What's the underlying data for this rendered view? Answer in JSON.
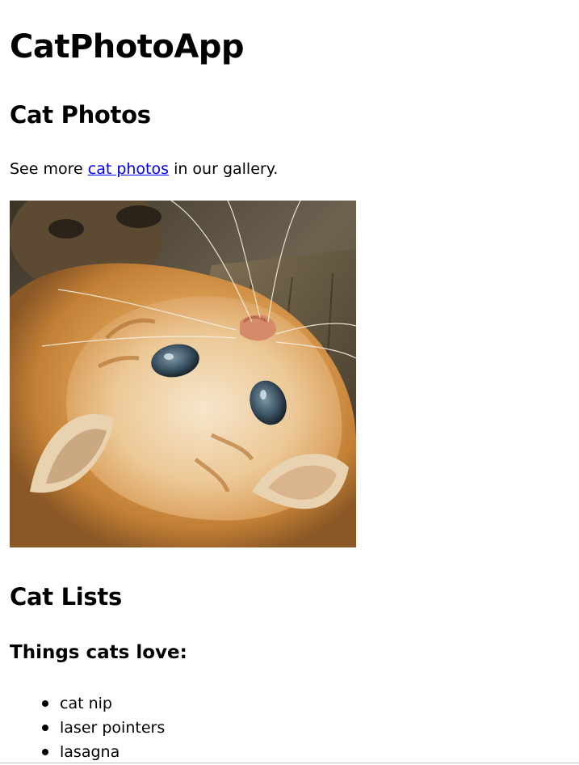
{
  "app_title": "CatPhotoApp",
  "photos_section": {
    "heading": "Cat Photos",
    "text_before": "See more ",
    "link_text": "cat photos",
    "text_after": " in our gallery.",
    "image_alt": "A cute orange cat lying on its back."
  },
  "lists_section": {
    "heading": "Cat Lists",
    "subheading": "Things cats love:",
    "items": [
      "cat nip",
      "laser pointers",
      "lasagna"
    ]
  },
  "colors": {
    "link": "#0000ee",
    "text": "#000000",
    "background": "#ffffff"
  }
}
